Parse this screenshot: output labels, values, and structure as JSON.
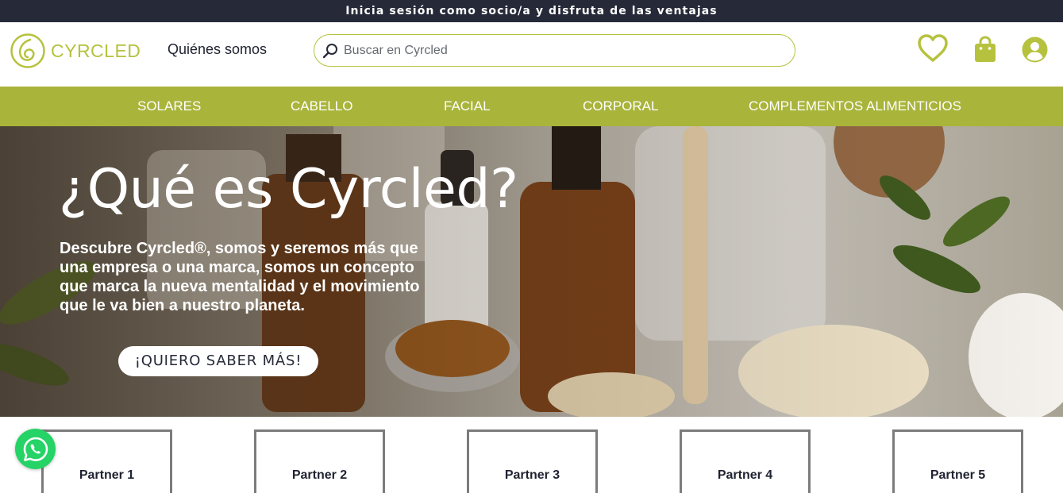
{
  "announcement": "Inicia sesión como socio/a y disfruta de las ventajas",
  "header": {
    "logo_text": "CYRCLED",
    "about_link": "Quiénes somos",
    "search_placeholder": "Buscar en Cyrcled"
  },
  "nav": {
    "items": [
      "SOLARES",
      "CABELLO",
      "FACIAL",
      "CORPORAL",
      "COMPLEMENTOS ALIMENTICIOS"
    ]
  },
  "hero": {
    "title": "¿Qué es Cyrcled?",
    "description": "Descubre Cyrcled®, somos y seremos más que una empresa o una marca, somos un concepto que marca la nueva mentalidad y el movimiento que le va bien a nuestro planeta.",
    "cta": "¡QUIERO SABER MÁS!"
  },
  "partners": [
    "Partner 1",
    "Partner 2",
    "Partner 3",
    "Partner 4",
    "Partner 5"
  ],
  "colors": {
    "brand_green": "#a9b43a",
    "logo_green": "#b6c23e",
    "dark_navy": "#262a38",
    "whatsapp_green": "#25d366"
  },
  "icons": [
    "search-icon",
    "heart-icon",
    "shopping-bag-icon",
    "user-account-icon",
    "whatsapp-icon"
  ]
}
